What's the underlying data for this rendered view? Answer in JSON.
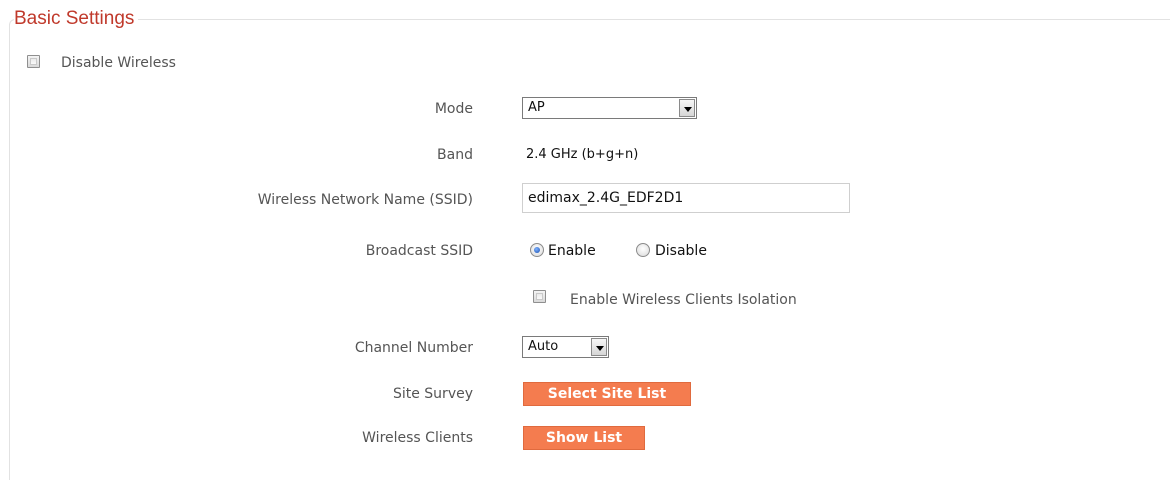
{
  "section": {
    "title": "Basic Settings"
  },
  "disable_wireless": {
    "label": "Disable  Wireless",
    "checked": false
  },
  "mode": {
    "label": "Mode",
    "value": "AP"
  },
  "band": {
    "label": "Band",
    "value": "2.4 GHz (b+g+n)"
  },
  "ssid": {
    "label": "Wireless Network Name  (SSID)",
    "value": "edimax_2.4G_EDF2D1"
  },
  "broadcast": {
    "label": "Broadcast SSID",
    "enable_label": "Enable",
    "disable_label": "Disable",
    "selected": "Enable"
  },
  "isolation": {
    "label": "Enable Wireless Clients Isolation",
    "checked": false
  },
  "channel": {
    "label": "Channel Number",
    "value": "Auto"
  },
  "site_survey": {
    "label": "Site Survey",
    "button": "Select Site List"
  },
  "wireless_clients": {
    "label": "Wireless Clients",
    "button": "Show List"
  },
  "colors": {
    "accent": "#f47c4f",
    "title": "#c0392b"
  }
}
